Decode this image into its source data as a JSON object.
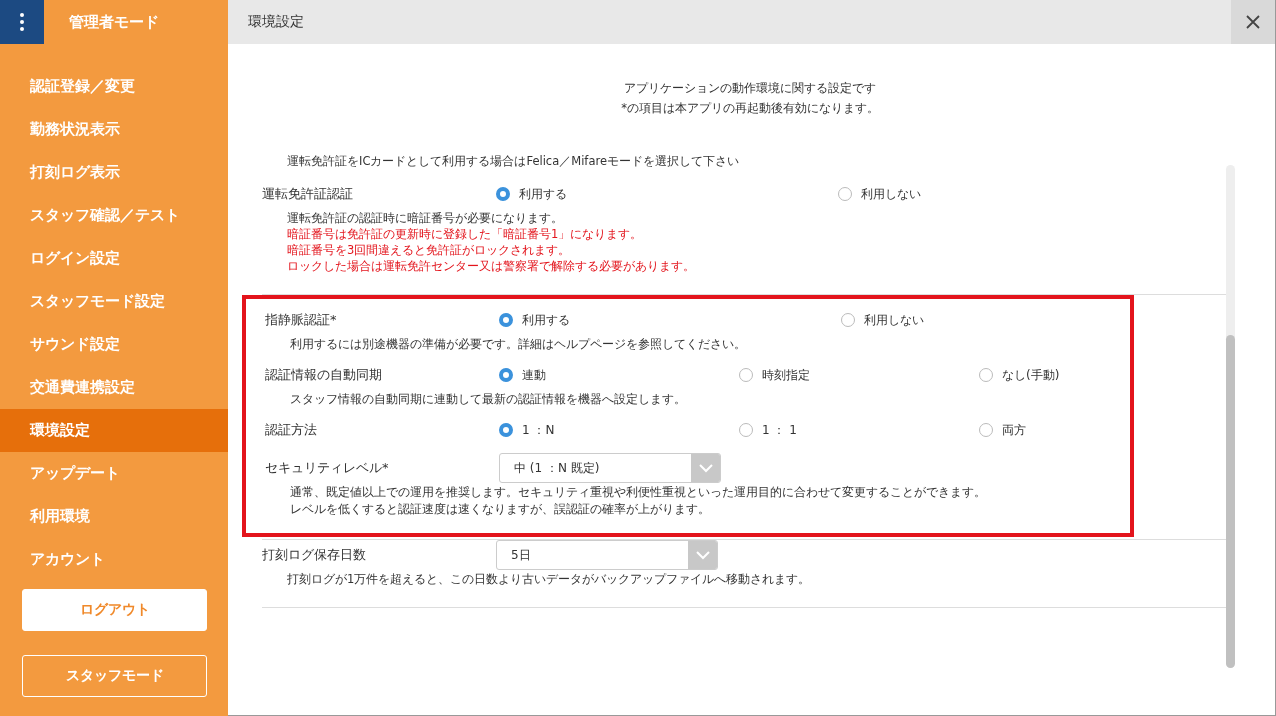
{
  "sidebar": {
    "title": "管理者モード",
    "items": [
      {
        "label": "認証登録／変更",
        "selected": false
      },
      {
        "label": "勤務状況表示",
        "selected": false
      },
      {
        "label": "打刻ログ表示",
        "selected": false
      },
      {
        "label": "スタッフ確認／テスト",
        "selected": false
      },
      {
        "label": "ログイン設定",
        "selected": false
      },
      {
        "label": "スタッフモード設定",
        "selected": false
      },
      {
        "label": "サウンド設定",
        "selected": false
      },
      {
        "label": "交通費連携設定",
        "selected": false
      },
      {
        "label": "環境設定",
        "selected": true
      },
      {
        "label": "アップデート",
        "selected": false
      },
      {
        "label": "利用環境",
        "selected": false
      },
      {
        "label": "アカウント",
        "selected": false
      }
    ],
    "logout_button": "ログアウト",
    "staff_mode_button": "スタッフモード"
  },
  "header": {
    "title": "環境設定"
  },
  "intro": [
    "アプリケーションの動作環境に関する設定です",
    "*の項目は本アプリの再起動後有効になります。"
  ],
  "sections": [
    {
      "highlighted": false,
      "note": "運転免許証をICカードとして利用する場合はFelica／Mifareモードを選択して下さい",
      "settings": [
        {
          "kind": "radio",
          "label": "運転免許証認証",
          "options": [
            {
              "label": "利用する",
              "selected": true
            },
            {
              "label": "利用しない",
              "selected": false
            }
          ],
          "description": [
            "運転免許証の認証時に暗証番号が必要になります。"
          ],
          "warnings": [
            "暗証番号は免許証の更新時に登録した「暗証番号1」になります。",
            "暗証番号を3回間違えると免許証がロックされます。",
            "ロックした場合は運転免許センター又は警察署で解除する必要があります。"
          ]
        }
      ]
    },
    {
      "highlighted": true,
      "settings": [
        {
          "kind": "radio",
          "label": "指静脈認証*",
          "options": [
            {
              "label": "利用する",
              "selected": true
            },
            {
              "label": "利用しない",
              "selected": false
            }
          ],
          "description": [
            "利用するには別途機器の準備が必要です。詳細はヘルプページを参照してください。"
          ]
        },
        {
          "kind": "radio",
          "label": "認証情報の自動同期",
          "options": [
            {
              "label": "連動",
              "selected": true
            },
            {
              "label": "時刻指定",
              "selected": false
            },
            {
              "label": "なし(手動)",
              "selected": false
            }
          ],
          "description": [
            "スタッフ情報の自動同期に連動して最新の認証情報を機器へ設定します。"
          ]
        },
        {
          "kind": "radio",
          "label": "認証方法",
          "options": [
            {
              "label": "1 ：N",
              "selected": true
            },
            {
              "label": "1 ： 1",
              "selected": false
            },
            {
              "label": "両方",
              "selected": false
            }
          ]
        },
        {
          "kind": "select",
          "label": "セキュリティレベル*",
          "value": "中 (1 ：N 既定)",
          "description": [
            "通常、既定値以上での運用を推奨します。セキュリティ重視や利便性重視といった運用目的に合わせて変更することができます。",
            "レベルを低くすると認証速度は速くなりますが、誤認証の確率が上がります。"
          ]
        }
      ]
    },
    {
      "highlighted": false,
      "settings": [
        {
          "kind": "select",
          "label": "打刻ログ保存日数",
          "value": "5日",
          "description": [
            "打刻ログが1万件を超えると、この日数より古いデータがバックアップファイルへ移動されます。"
          ]
        }
      ]
    }
  ]
}
